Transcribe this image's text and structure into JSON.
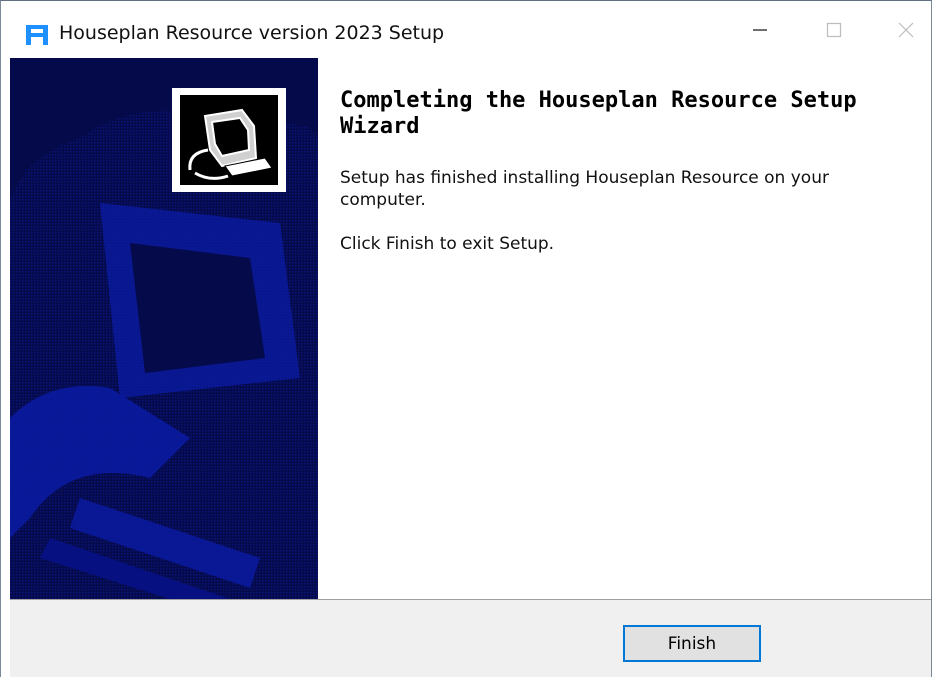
{
  "window": {
    "title": "Houseplan Resource version 2023 Setup"
  },
  "controls": {
    "minimize_icon": "minimize-icon",
    "maximize_icon": "maximize-icon",
    "close_icon": "close-icon"
  },
  "content": {
    "heading": "Completing the Houseplan Resource Setup Wizard",
    "paragraph1": "Setup has finished installing Houseplan Resource on your computer.",
    "paragraph2": "Click Finish to exit Setup."
  },
  "footer": {
    "finish_label": "Finish"
  },
  "colors": {
    "sidebar_bg": "#050a4a",
    "accent": "#0078d7",
    "app_icon": "#1e90ff"
  }
}
